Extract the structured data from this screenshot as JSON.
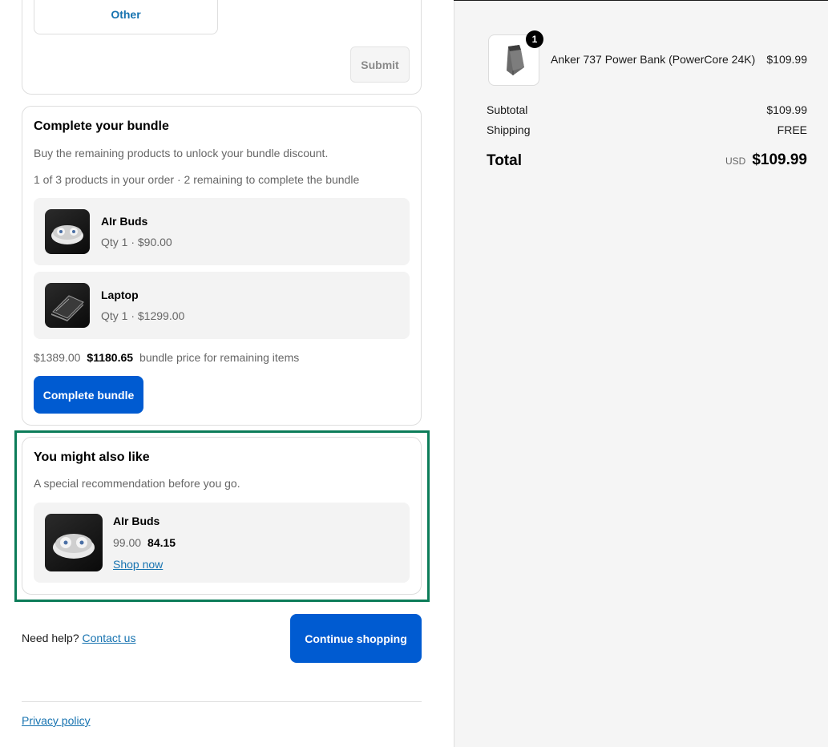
{
  "survey": {
    "other_label": "Other",
    "submit_label": "Submit"
  },
  "bundle": {
    "title": "Complete your bundle",
    "description": "Buy the remaining products to unlock your bundle discount.",
    "progress": "1 of 3 products in your order · 2 remaining to complete the bundle",
    "items": [
      {
        "name": "AIr Buds",
        "meta": "Qty 1 · $90.00",
        "icon": "earbuds-image"
      },
      {
        "name": "Laptop",
        "meta": "Qty 1 · $1299.00",
        "icon": "laptop-image"
      }
    ],
    "original_price": "$1389.00",
    "bundle_price": "$1180.65",
    "price_note": "bundle price for remaining items",
    "button_label": "Complete bundle"
  },
  "recommendation": {
    "title": "You might also like",
    "description": "A special recommendation before you go.",
    "item": {
      "name": "AIr Buds",
      "old_price": "99.00",
      "new_price": "84.15",
      "link_label": "Shop now"
    }
  },
  "footer": {
    "help_text": "Need help?",
    "contact_label": "Contact us",
    "continue_label": "Continue shopping",
    "privacy_label": "Privacy policy"
  },
  "summary": {
    "product": {
      "name": "Anker 737 Power Bank (PowerCore 24K)",
      "price": "$109.99",
      "quantity": "1"
    },
    "subtotal_label": "Subtotal",
    "subtotal_value": "$109.99",
    "shipping_label": "Shipping",
    "shipping_value": "FREE",
    "total_label": "Total",
    "currency": "USD",
    "total_value": "$109.99"
  },
  "colors": {
    "accent": "#005bd1",
    "link": "#1773b0",
    "highlight": "#0c7c59"
  }
}
